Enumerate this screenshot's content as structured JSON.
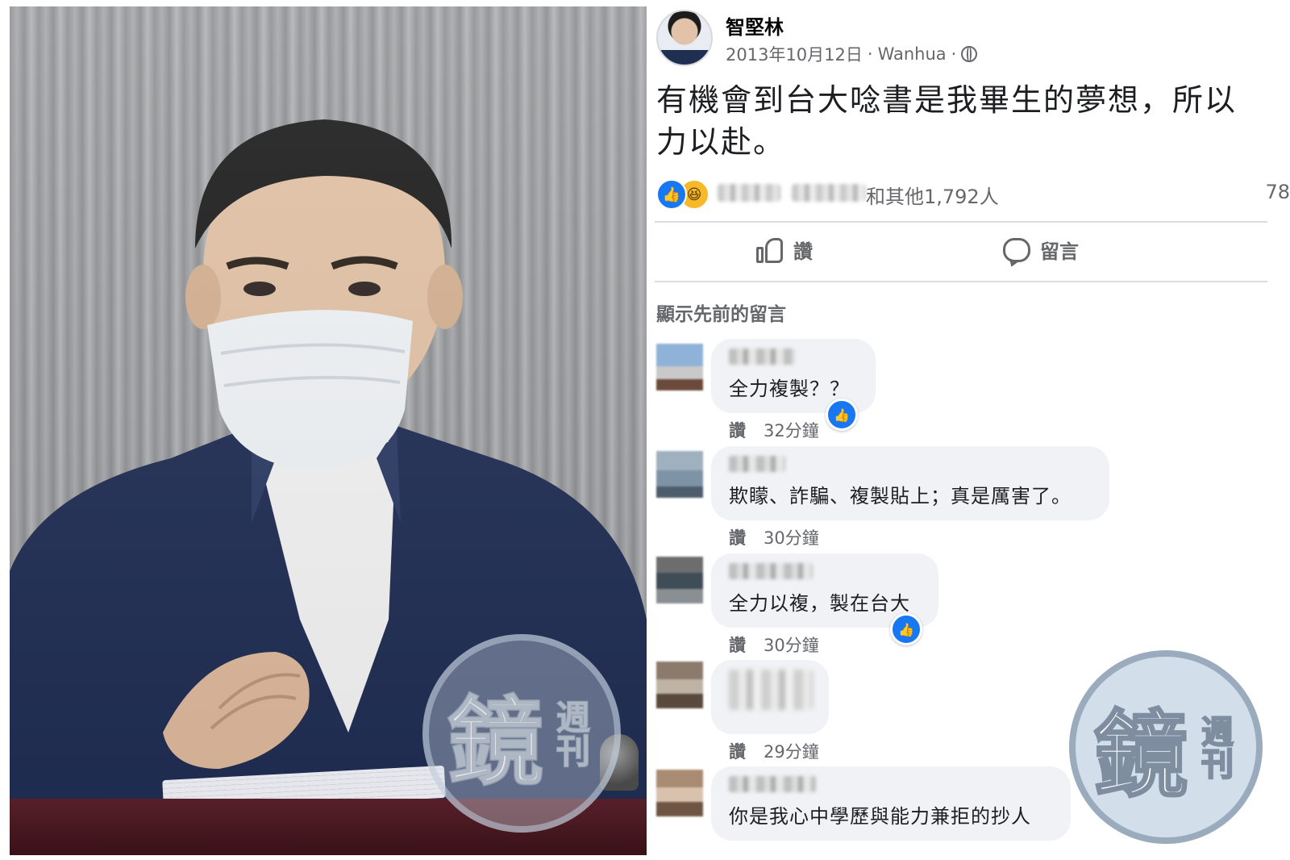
{
  "post": {
    "author": "智堅林",
    "date": "2013年10月12日",
    "location": "Wanhua",
    "separator": "·",
    "privacy_icon": "globe-icon",
    "text_line1": "有機會到台大唸書是我畢生的夢想，所以",
    "text_line2": "力以赴。"
  },
  "reactions": {
    "icons": [
      "like-icon",
      "haha-icon"
    ],
    "summary_text": "和其他1,792人",
    "comment_count": "78"
  },
  "actions": {
    "like_label": "讚",
    "comment_label": "留言"
  },
  "comments_section": {
    "show_previous": "顯示先前的留言",
    "like_action": "讚",
    "items": [
      {
        "text": "全力複製？？",
        "time": "32分鐘",
        "liked": true
      },
      {
        "text": "欺矇、詐騙、複製貼上；真是厲害了。",
        "time": "30分鐘",
        "liked": false
      },
      {
        "text": "全力以複，製在台大",
        "time": "30分鐘",
        "liked": true
      },
      {
        "text": "",
        "time": "29分鐘",
        "liked": false
      },
      {
        "text": "你是我心中學歷與能力兼拒的抄人",
        "time": "",
        "liked": false
      }
    ]
  },
  "watermark": {
    "main": "鏡",
    "sub": "週刊"
  },
  "colors": {
    "facebook_blue": "#1877f2",
    "haha_yellow": "#f7b928",
    "secondary_text": "#65676b",
    "comment_bubble": "#f0f2f5"
  }
}
